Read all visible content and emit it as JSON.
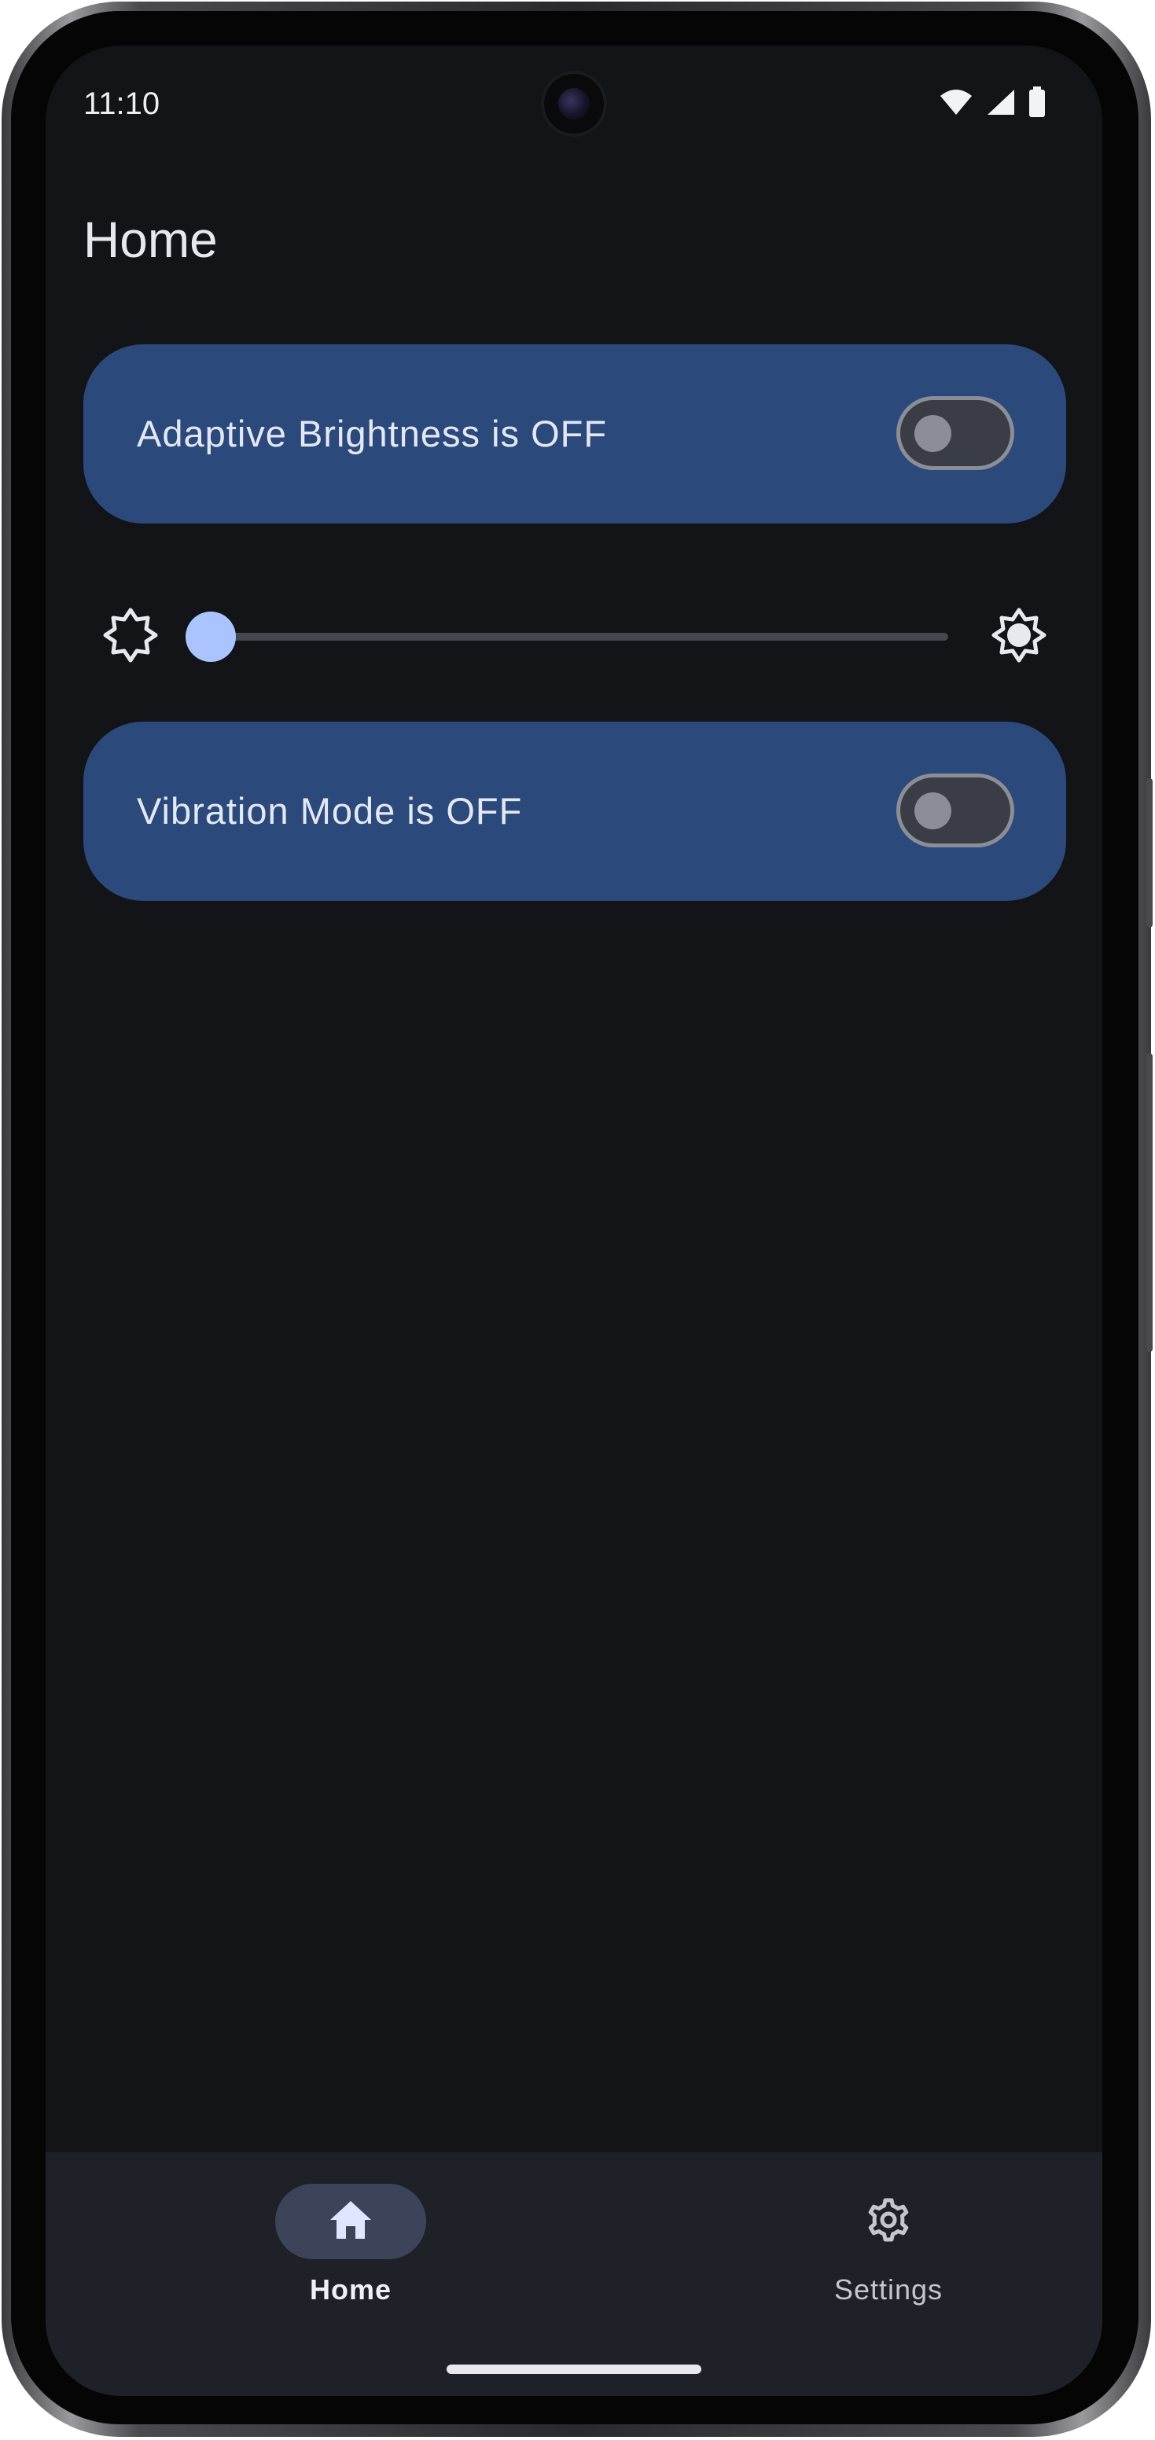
{
  "status_bar": {
    "time": "11:10",
    "icons": [
      "wifi-icon",
      "signal-icon",
      "battery-icon"
    ]
  },
  "page": {
    "title": "Home"
  },
  "adaptive_brightness": {
    "label": "Adaptive Brightness is OFF",
    "enabled": false
  },
  "brightness_slider": {
    "value_fraction": 0.0,
    "low_icon": "brightness-low-icon",
    "high_icon": "brightness-high-icon"
  },
  "vibration_mode": {
    "label": "Vibration Mode is OFF",
    "enabled": false
  },
  "bottom_nav": {
    "items": [
      {
        "label": "Home",
        "icon": "home-icon",
        "selected": true
      },
      {
        "label": "Settings",
        "icon": "gear-icon",
        "selected": false
      }
    ]
  },
  "colors": {
    "background": "#131418",
    "card": "#2c497b",
    "accent": "#a9c4ff",
    "nav_background": "#1f2128",
    "nav_selected_pill": "#3d4459"
  }
}
